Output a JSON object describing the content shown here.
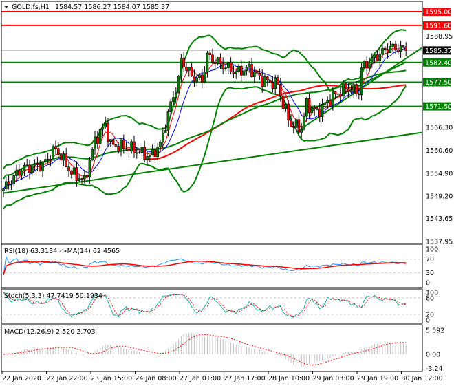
{
  "header": {
    "symbol": "GOLD.fs,H1",
    "ohlc": "1584.57 1586.27 1584.07 1585.37"
  },
  "colors": {
    "up": "#008000",
    "down": "#ff0000",
    "band": "#008000",
    "ma_fast": "#ff0000",
    "ma_slow": "#0000ff",
    "level_red": "#ff0000",
    "level_green": "#008000",
    "rsi": "#1e90ff",
    "stoch_main": "#20b2aa",
    "stoch_signal": "#ff0000",
    "macd_hist": "#c0c0c0",
    "macd_signal": "#ff0000"
  },
  "chart_data": {
    "type": "candlestick",
    "symbol": "GOLD.fs",
    "timeframe": "H1",
    "ylim": [
      1537.95,
      1597
    ],
    "price_ticks": [
      "1588.95",
      "1566.30",
      "1560.60",
      "1554.90",
      "1549.20",
      "1543.65",
      "1537.95"
    ],
    "current_price": "1585.37",
    "levels": [
      {
        "price": 1595.0,
        "label": "1595.00",
        "color": "red"
      },
      {
        "price": 1591.6,
        "label": "1591.60",
        "color": "red"
      },
      {
        "price": 1582.4,
        "label": "1582.40",
        "color": "green"
      },
      {
        "price": 1577.5,
        "label": "1577.50",
        "color": "green"
      },
      {
        "price": 1571.5,
        "label": "1571.50",
        "color": "green"
      }
    ],
    "close_waypoints": [
      [
        0,
        1551
      ],
      [
        7,
        1556
      ],
      [
        15,
        1557
      ],
      [
        20,
        1561
      ],
      [
        26,
        1555
      ],
      [
        31,
        1553
      ],
      [
        35,
        1563
      ],
      [
        39,
        1567
      ],
      [
        41,
        1562
      ],
      [
        49,
        1561
      ],
      [
        56,
        1559
      ],
      [
        60,
        1562
      ],
      [
        64,
        1572
      ],
      [
        67,
        1578
      ],
      [
        68,
        1583
      ],
      [
        72,
        1579
      ],
      [
        76,
        1578
      ],
      [
        78,
        1584
      ],
      [
        83,
        1582
      ],
      [
        89,
        1580
      ],
      [
        94,
        1581
      ],
      [
        99,
        1578
      ],
      [
        105,
        1577
      ],
      [
        107,
        1572
      ],
      [
        110,
        1567
      ],
      [
        114,
        1566
      ],
      [
        116,
        1572
      ],
      [
        120,
        1570
      ],
      [
        126,
        1574
      ],
      [
        131,
        1576
      ],
      [
        136,
        1575
      ],
      [
        137,
        1581
      ],
      [
        141,
        1583
      ],
      [
        147,
        1586
      ],
      [
        151,
        1586
      ],
      [
        154,
        1585.37
      ]
    ],
    "trendlines": [
      [
        [
          0,
          1550
        ],
        [
          160,
          1565
        ]
      ],
      [
        [
          114,
          1566
        ],
        [
          160,
          1586
        ]
      ],
      [
        [
          116,
          1570
        ],
        [
          154,
          1582.5
        ]
      ]
    ],
    "time_labels": [
      "22 Jan 2020",
      "22 Jan 22:00",
      "23 Jan 15:00",
      "24 Jan 08:00",
      "27 Jan 01:00",
      "27 Jan 17:00",
      "28 Jan 10:00",
      "29 Jan 03:00",
      "29 Jan 19:00",
      "30 Jan 12:00"
    ],
    "indicators": {
      "rsi": {
        "label": "RSI(18) 63.3134  ->MA(14) 62.4565",
        "ticks": [
          "100",
          "70",
          "30",
          "0"
        ],
        "levels": [
          70,
          30
        ]
      },
      "stoch": {
        "label": "Stoch(5,3,3) 47.7419 50.1934",
        "ticks": [
          "100",
          "80",
          "20",
          "0"
        ],
        "levels": [
          80,
          20
        ]
      },
      "macd": {
        "label": "MACD(12,26,9) 2.520 2.703",
        "ticks": [
          "5.592",
          "0.00",
          "-3.24"
        ],
        "range": [
          -3.24,
          5.592
        ]
      }
    }
  }
}
